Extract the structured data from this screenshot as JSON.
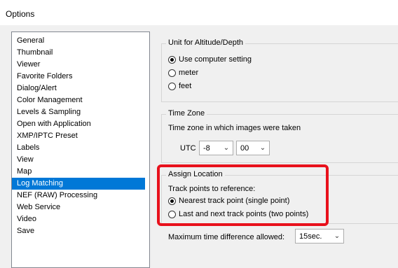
{
  "window": {
    "title": "Options"
  },
  "sidebar": {
    "items": [
      {
        "label": "General",
        "selected": false
      },
      {
        "label": "Thumbnail",
        "selected": false
      },
      {
        "label": "Viewer",
        "selected": false
      },
      {
        "label": "Favorite Folders",
        "selected": false
      },
      {
        "label": "Dialog/Alert",
        "selected": false
      },
      {
        "label": "Color Management",
        "selected": false
      },
      {
        "label": "Levels & Sampling",
        "selected": false
      },
      {
        "label": "Open with Application",
        "selected": false
      },
      {
        "label": "XMP/IPTC Preset",
        "selected": false
      },
      {
        "label": "Labels",
        "selected": false
      },
      {
        "label": "View",
        "selected": false
      },
      {
        "label": "Map",
        "selected": false
      },
      {
        "label": "Log Matching",
        "selected": true
      },
      {
        "label": "NEF (RAW) Processing",
        "selected": false
      },
      {
        "label": "Web Service",
        "selected": false
      },
      {
        "label": "Video",
        "selected": false
      },
      {
        "label": "Save",
        "selected": false
      }
    ]
  },
  "unit_group": {
    "title": "Unit for Altitude/Depth",
    "options": [
      {
        "label": "Use computer setting",
        "checked": true
      },
      {
        "label": "meter",
        "checked": false
      },
      {
        "label": "feet",
        "checked": false
      }
    ]
  },
  "timezone_group": {
    "title": "Time Zone",
    "description": "Time zone in which images were taken",
    "utc_label": "UTC",
    "hours_value": "-8",
    "minutes_value": "00"
  },
  "location_group": {
    "title": "Assign Location",
    "subtitle": "Track points to reference:",
    "options": [
      {
        "label": "Nearest track point (single point)",
        "checked": true
      },
      {
        "label": "Last and next track points (two points)",
        "checked": false
      }
    ]
  },
  "max_time": {
    "label": "Maximum time difference allowed:",
    "value": "15sec."
  },
  "colors": {
    "selection": "#0078d7",
    "highlight": "#e8111c"
  }
}
